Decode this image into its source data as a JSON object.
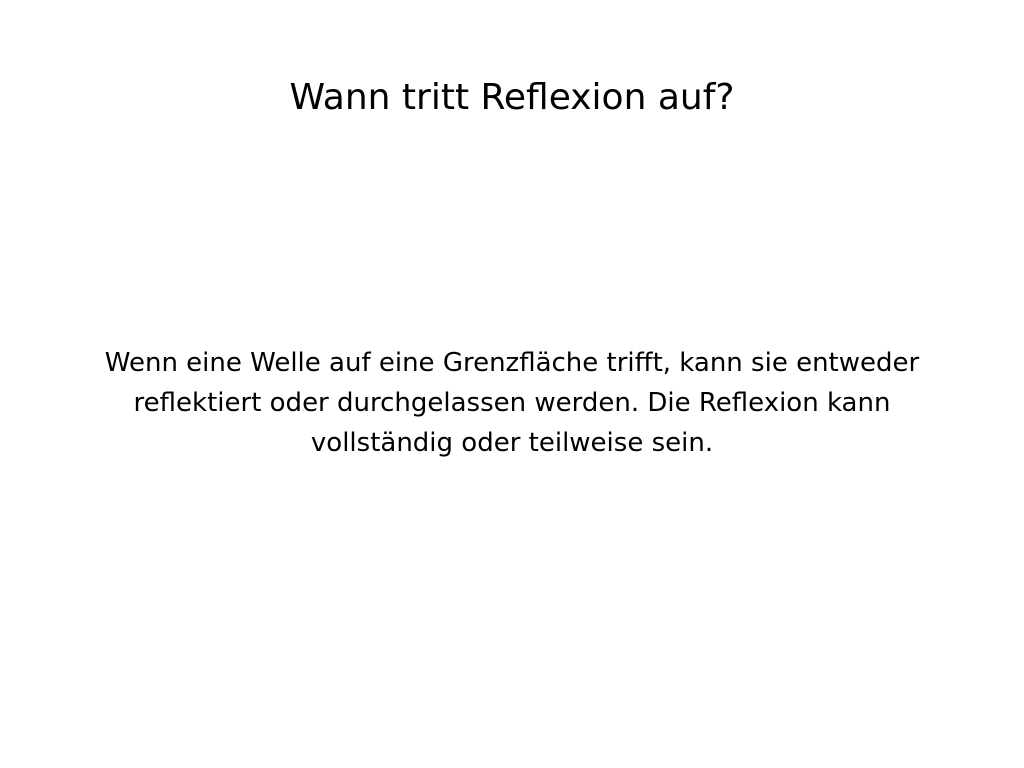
{
  "slide": {
    "title": "Wann tritt Reflexion auf?",
    "body": "Wenn eine Welle auf eine Grenzfläche trifft, kann sie entweder reflektiert oder durchgelassen werden. Die Reflexion kann vollständig oder teilweise sein."
  },
  "colors": {
    "background": "#ffffff",
    "text": "#000000"
  }
}
